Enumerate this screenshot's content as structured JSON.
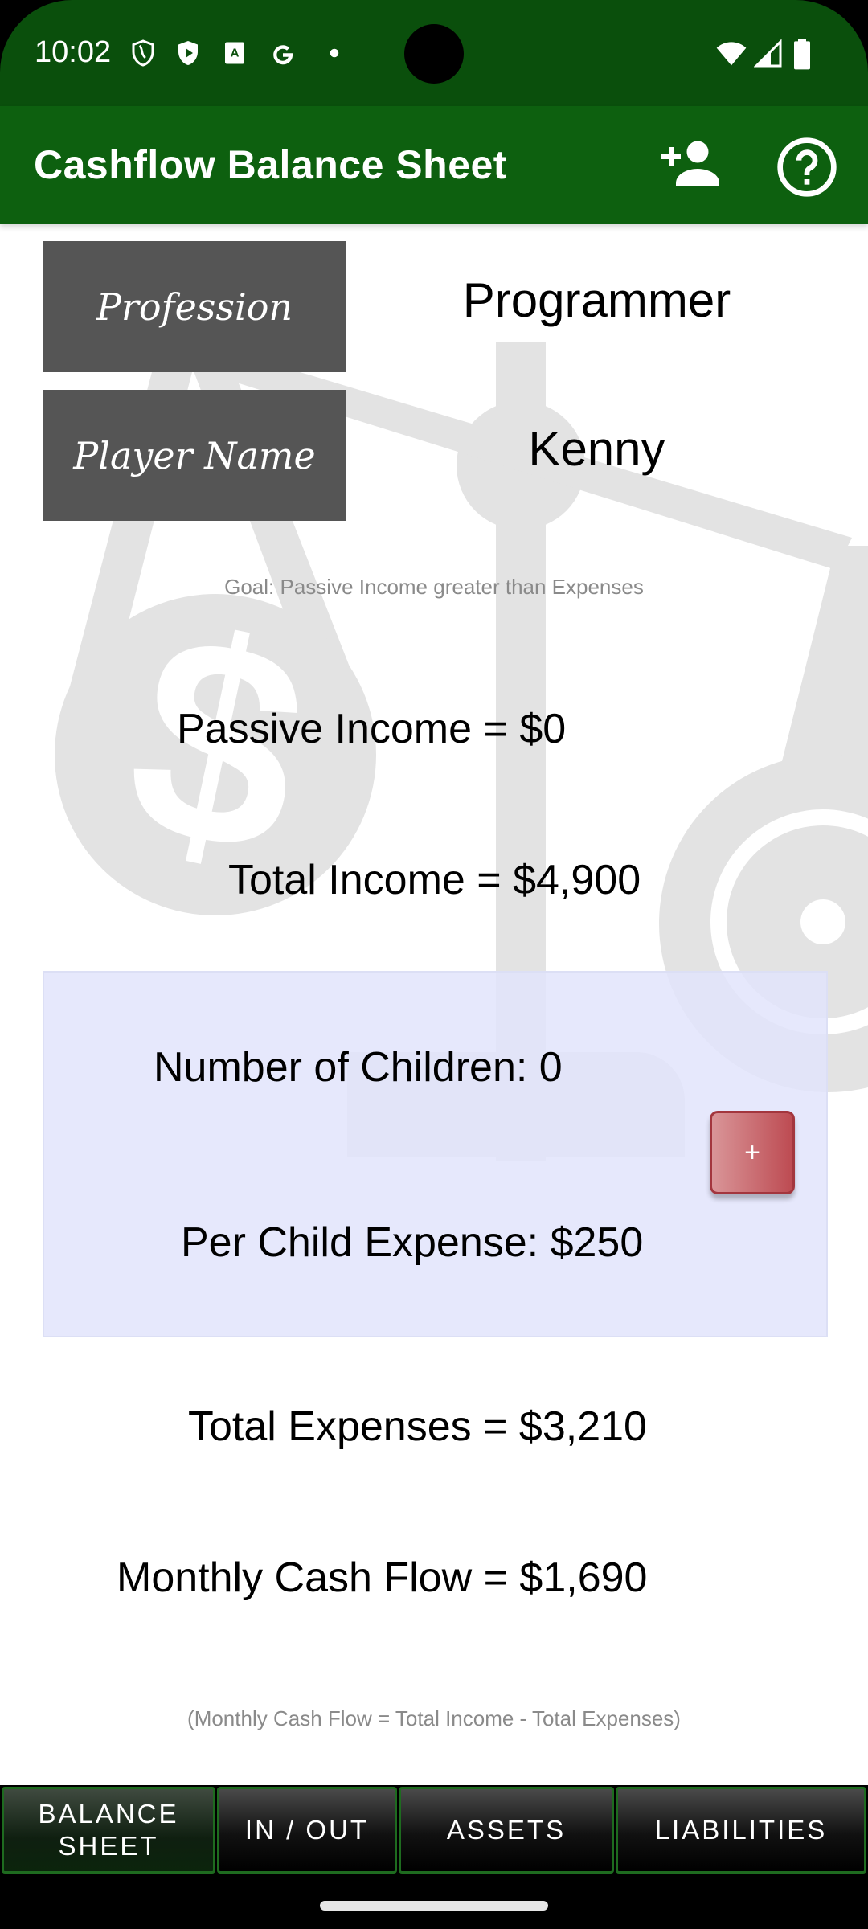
{
  "status_bar": {
    "time": "10:02",
    "left_icons": [
      "shield-outline-icon",
      "play-protect-icon",
      "accessibility-a-icon",
      "google-g-icon",
      "notification-dot-icon"
    ],
    "right_icons": [
      "wifi-icon",
      "cell-signal-icon",
      "battery-icon"
    ]
  },
  "app_bar": {
    "title": "Cashflow Balance Sheet",
    "actions": [
      "add-player-icon",
      "help-icon"
    ]
  },
  "profile": {
    "profession_label": "Profession",
    "profession_value": "Programmer",
    "player_name_label": "Player Name",
    "player_name_value": "Kenny"
  },
  "goal_text": "Goal: Passive Income greater than Expenses",
  "summary": {
    "passive_income_label": "Passive Income = ",
    "passive_income_value": "$0",
    "total_income_label": "Total Income = ",
    "total_income_value": "$4,900",
    "total_expenses_label": "Total Expenses = ",
    "total_expenses_value": "$3,210",
    "cash_flow_label": "Monthly Cash Flow = ",
    "cash_flow_value": "$1,690"
  },
  "children": {
    "count_label": "Number of Children: ",
    "count_value": "0",
    "per_child_label": "Per Child Expense: ",
    "per_child_value": "$250",
    "add_button_label": "+"
  },
  "formula_text": "(Monthly Cash Flow = Total Income - Total Expenses)",
  "tabs": [
    {
      "label": "BALANCE\nSHEET",
      "line1": "BALANCE",
      "line2": "SHEET",
      "active": true
    },
    {
      "label": "IN / OUT",
      "active": false
    },
    {
      "label": "ASSETS",
      "active": false
    },
    {
      "label": "LIABILITIES",
      "active": false
    }
  ],
  "colors": {
    "status_bar": "#0a4f0c",
    "app_bar": "#0d600f",
    "label_box": "#555555",
    "children_panel": "#e8eafc",
    "add_button": "#c45a61",
    "tab_border": "#1e6b1f"
  }
}
